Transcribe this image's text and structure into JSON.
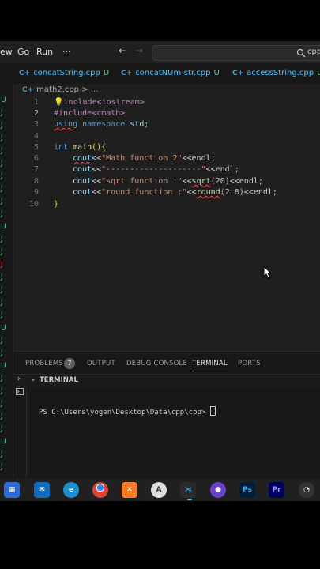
{
  "menu": {
    "view_partial": "ew",
    "go": "Go",
    "run": "Run",
    "more": "···",
    "back_icon": "←",
    "fwd_icon": "→",
    "search_text": "cpp"
  },
  "tabs": [
    {
      "icon": "C+",
      "label": "concatString.cpp",
      "status": "U"
    },
    {
      "icon": "C+",
      "label": "concatNUm-str.cpp",
      "status": "U"
    },
    {
      "icon": "C+",
      "label": "accessString.cpp",
      "status": "U"
    }
  ],
  "breadcrumb": {
    "icon": "C+",
    "file": "math2.cpp",
    "sep": ">",
    "rest": "..."
  },
  "editor": {
    "line_numbers": [
      "1",
      "2",
      "3",
      "4",
      "5",
      "6",
      "7",
      "8",
      "9",
      "10"
    ],
    "lines": [
      {
        "a": "#",
        "b": "include<iostream>"
      },
      {
        "a": "#include",
        "b": "<cmath>"
      },
      {
        "a": "using",
        "b": " namespace",
        "c": " std;"
      },
      {},
      {
        "a": "int",
        "b": " main",
        "c": "(){"
      },
      {
        "a": "cout",
        "b": "<<",
        "c": "\"Math function 2\"",
        "d": "<<endl;"
      },
      {
        "a": "cout",
        "b": "<<",
        "c": "\"--------------------\"",
        "d": "<<endl;"
      },
      {
        "a": "cout",
        "b": "<<",
        "c": "\"sqrt function :\"",
        "d": "<<",
        "e": "sqrt",
        "f": "(",
        "g": "20",
        "h": ")<<endl;"
      },
      {
        "a": "cout",
        "b": "<<",
        "c": "\"round function :\"",
        "d": "<<",
        "e": "round",
        "f": "(",
        "g": "2.8",
        "h": ")<<endl;"
      },
      {
        "a": "}"
      }
    ]
  },
  "panel": {
    "tabs": [
      "PROBLEMS",
      "OUTPUT",
      "DEBUG CONSOLE",
      "TERMINAL",
      "PORTS"
    ],
    "problems_count": "7",
    "section_title": "TERMINAL",
    "prompt": "PS C:\\Users\\yogen\\Desktop\\Data\\cpp\\cpp> "
  },
  "gutter_marks": [
    "U",
    "J",
    "J",
    "J",
    "J",
    "J",
    "J",
    "J",
    "J",
    "J",
    "U",
    "J",
    "J",
    "J",
    "J",
    "J",
    "J",
    "J",
    "U",
    "J",
    "J",
    "U",
    "J",
    "J",
    "J",
    "J",
    "J",
    "U",
    "J",
    "J"
  ],
  "taskbar_icons": [
    "store-icon",
    "mail-icon",
    "edge-icon",
    "chrome-icon",
    "xampp-icon",
    "git-icon",
    "vscode-icon",
    "github-icon",
    "photoshop-icon",
    "premiere-icon",
    "other-icon"
  ],
  "taskbar_labels": {
    "ps": "Ps",
    "pr": "Pr"
  },
  "colors": {
    "accent": "#0078d4",
    "editor_bg": "#1f1f1f",
    "untracked": "#73c991",
    "error": "#f14c4c"
  }
}
